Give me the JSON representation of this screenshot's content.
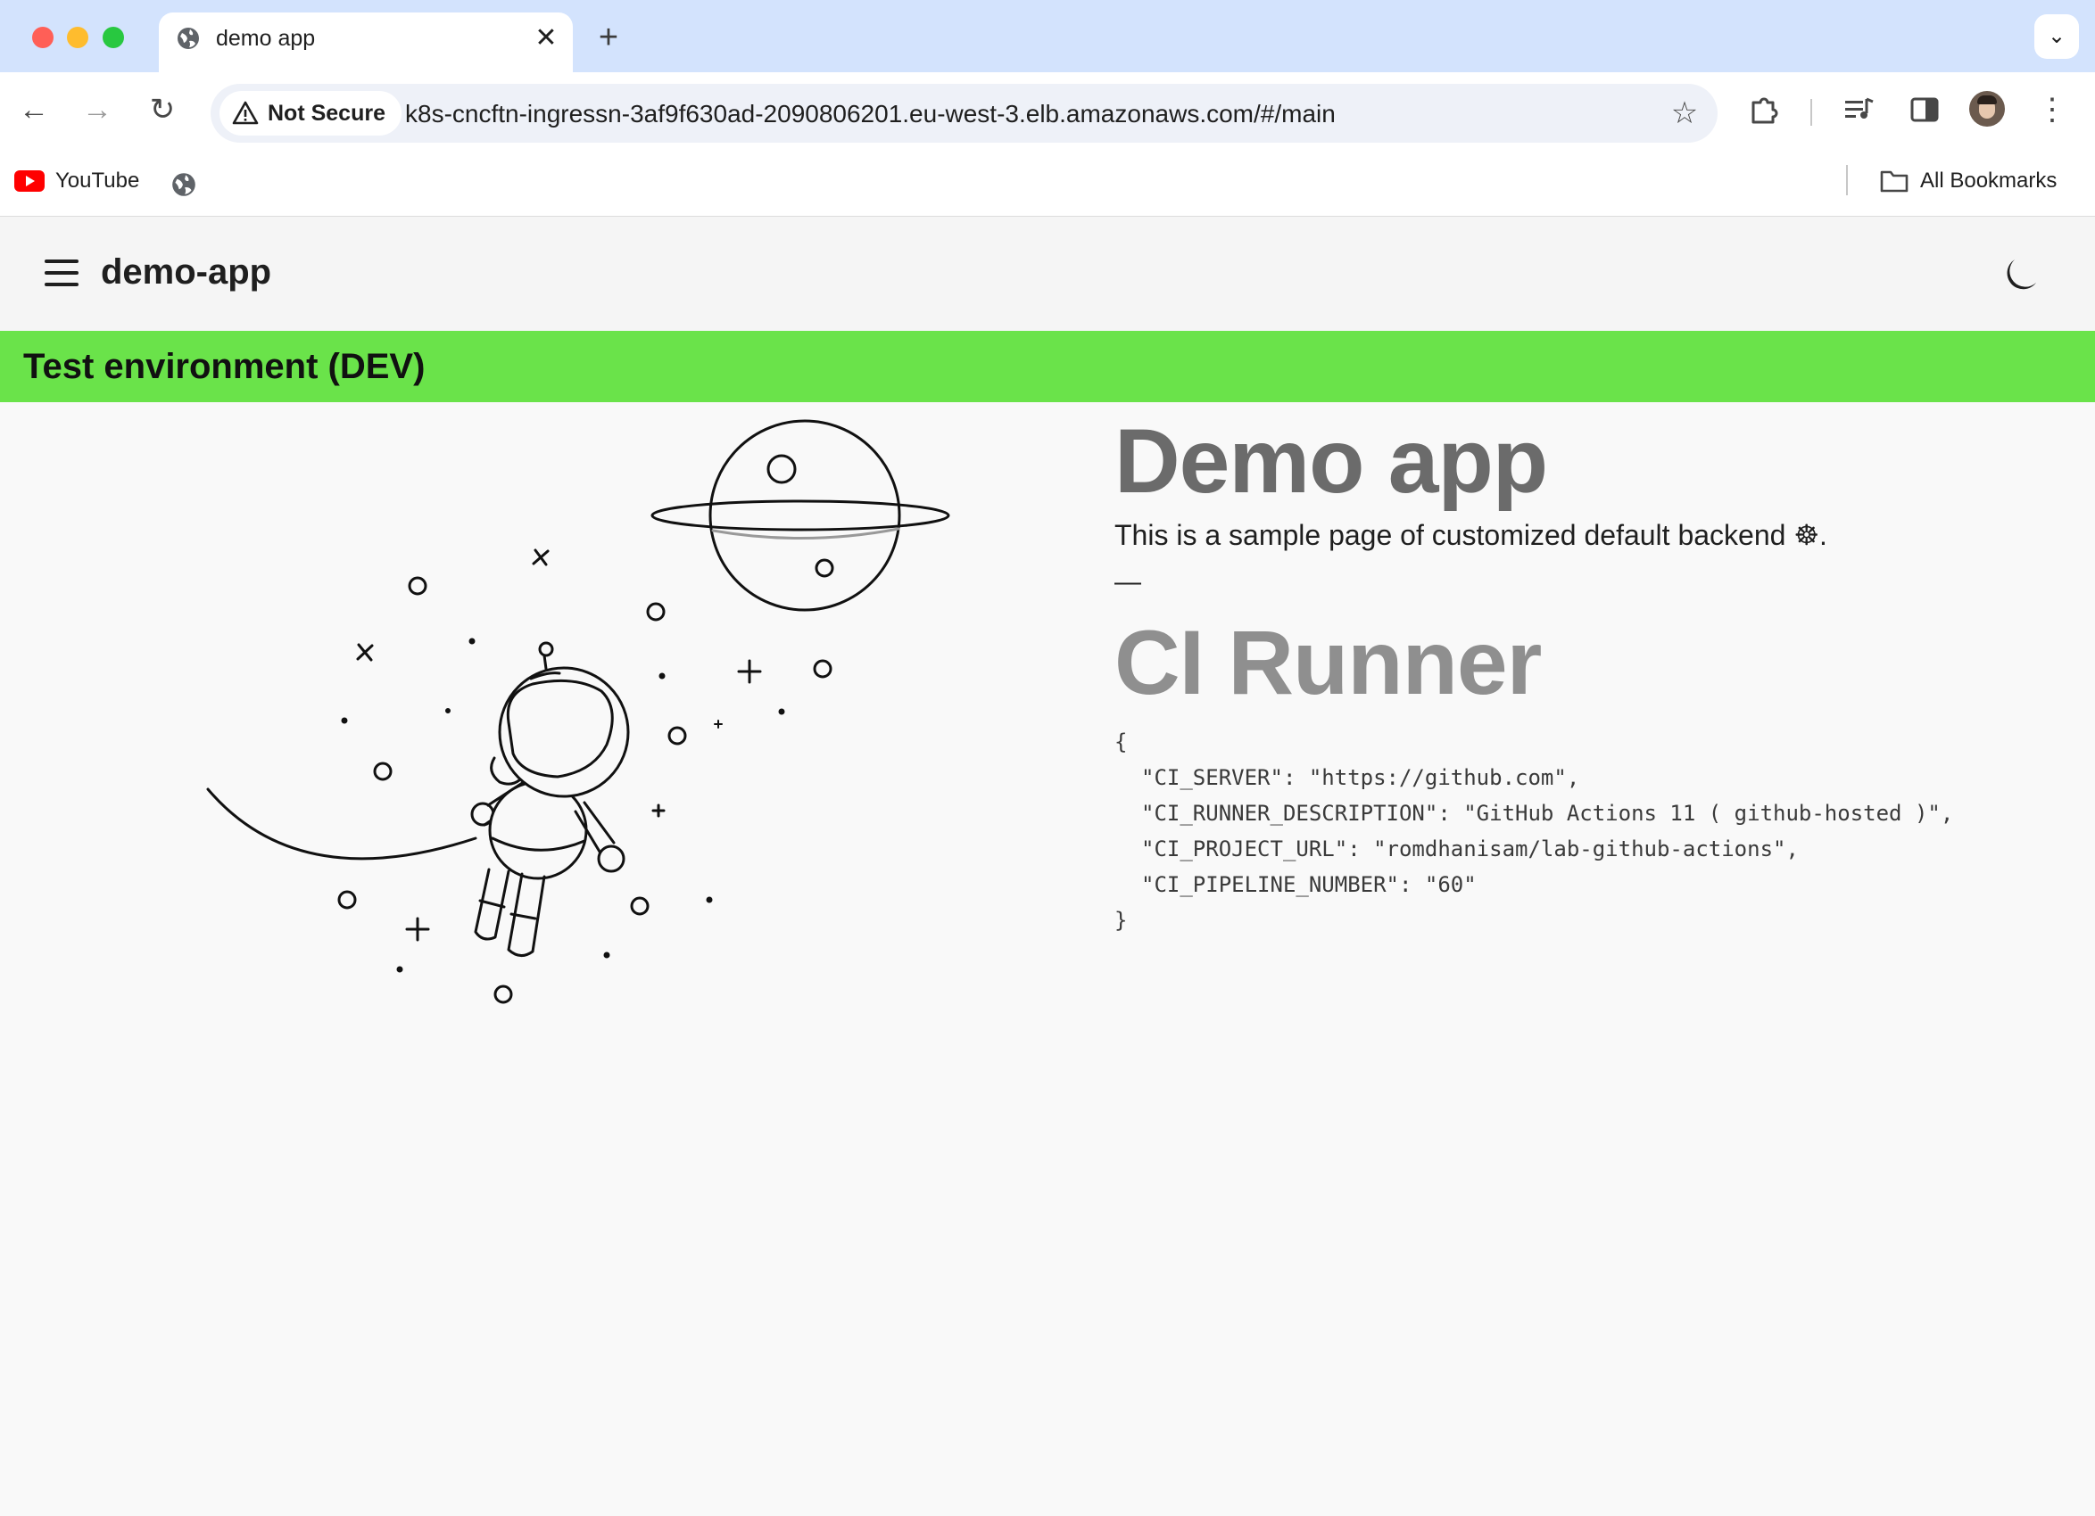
{
  "browser": {
    "tab_title": "demo app",
    "security_label": "Not Secure",
    "url": "k8s-cncftn-ingressn-3af9f630ad-2090806201.eu-west-3.elb.amazonaws.com/#/main",
    "bookmarks": {
      "youtube_label": "YouTube",
      "all_bookmarks_label": "All Bookmarks"
    }
  },
  "app": {
    "title": "demo-app",
    "env_banner": "Test environment (DEV)",
    "env_banner_color": "#6ae34a"
  },
  "main": {
    "heading": "Demo app",
    "tagline": "This is a sample page of customized default backend ☸.",
    "separator": "—",
    "ci_heading": "CI Runner",
    "ci_json": {
      "open": "{",
      "close": "}",
      "lines": [
        "\"CI_SERVER\": \"https://github.com\",",
        "\"CI_RUNNER_DESCRIPTION\": \"GitHub Actions 11 ( github-hosted )\",",
        "\"CI_PROJECT_URL\": \"romdhanisam/lab-github-actions\",",
        "\"CI_PIPELINE_NUMBER\": \"60\""
      ]
    }
  },
  "icons": {
    "tab_favicon": "globe-icon",
    "theme_toggle": "moon-icon",
    "menu": "hamburger-menu-icon"
  }
}
